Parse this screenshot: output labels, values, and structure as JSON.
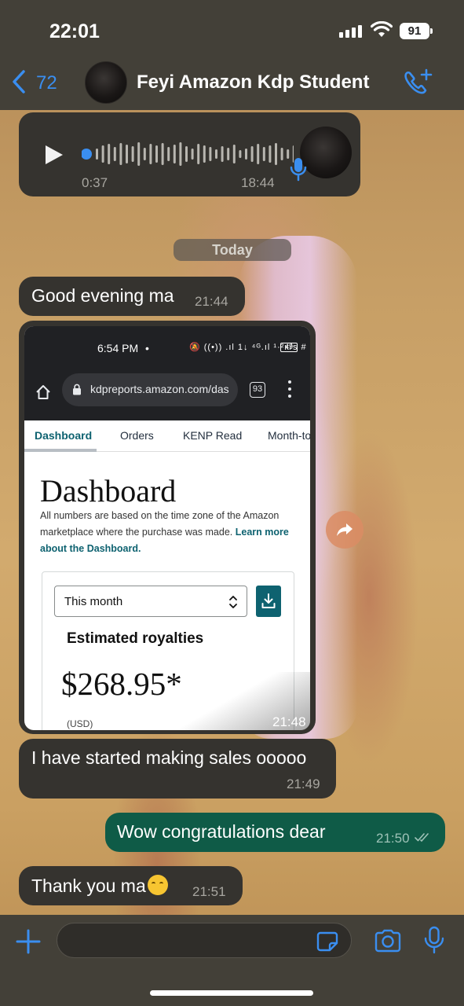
{
  "status_bar": {
    "time": "22:01",
    "battery": "91"
  },
  "header": {
    "back_count": "72",
    "contact_name": "Feyi Amazon Kdp Student"
  },
  "voice_note": {
    "duration": "0:37",
    "time": "18:44"
  },
  "date_separator": "Today",
  "messages": [
    {
      "direction": "incoming",
      "text": "Good evening ma",
      "time": "21:44"
    },
    {
      "direction": "incoming",
      "type": "image",
      "time": "21:48"
    },
    {
      "direction": "incoming",
      "text": "I have started making sales ooooo",
      "time": "21:49"
    },
    {
      "direction": "outgoing",
      "text": "Wow congratulations dear",
      "time": "21:50",
      "status": "read"
    },
    {
      "direction": "incoming",
      "text": "Thank you ma",
      "emoji": "relieved-face",
      "time": "21:51"
    }
  ],
  "screenshot": {
    "status_time": "6:54 PM",
    "status_dot": "•",
    "status_icons": "🔕 ((•)) .ıl 1↓ ⁴ᴳ.ıl ¹·²ᴋ/s #",
    "battery": "49",
    "url": "kdpreports.amazon.com/das",
    "tab_count": "93",
    "tabs": [
      "Dashboard",
      "Orders",
      "KENP Read",
      "Month-to"
    ],
    "title": "Dashboard",
    "description": "All numbers are based on the time zone of the Amazon marketplace where the purchase was made.",
    "learn_link": "Learn more about the Dashboard.",
    "period_select": "This month",
    "royalties_label": "Estimated royalties",
    "royalties_value": "$268.95*",
    "currency": "(USD)"
  },
  "input": {
    "placeholder": ""
  },
  "colors": {
    "accent": "#3a8ef0",
    "outgoing_bubble": "#0f5b47",
    "incoming_bubble": "#35332f",
    "kdp_teal": "#0e6270"
  }
}
